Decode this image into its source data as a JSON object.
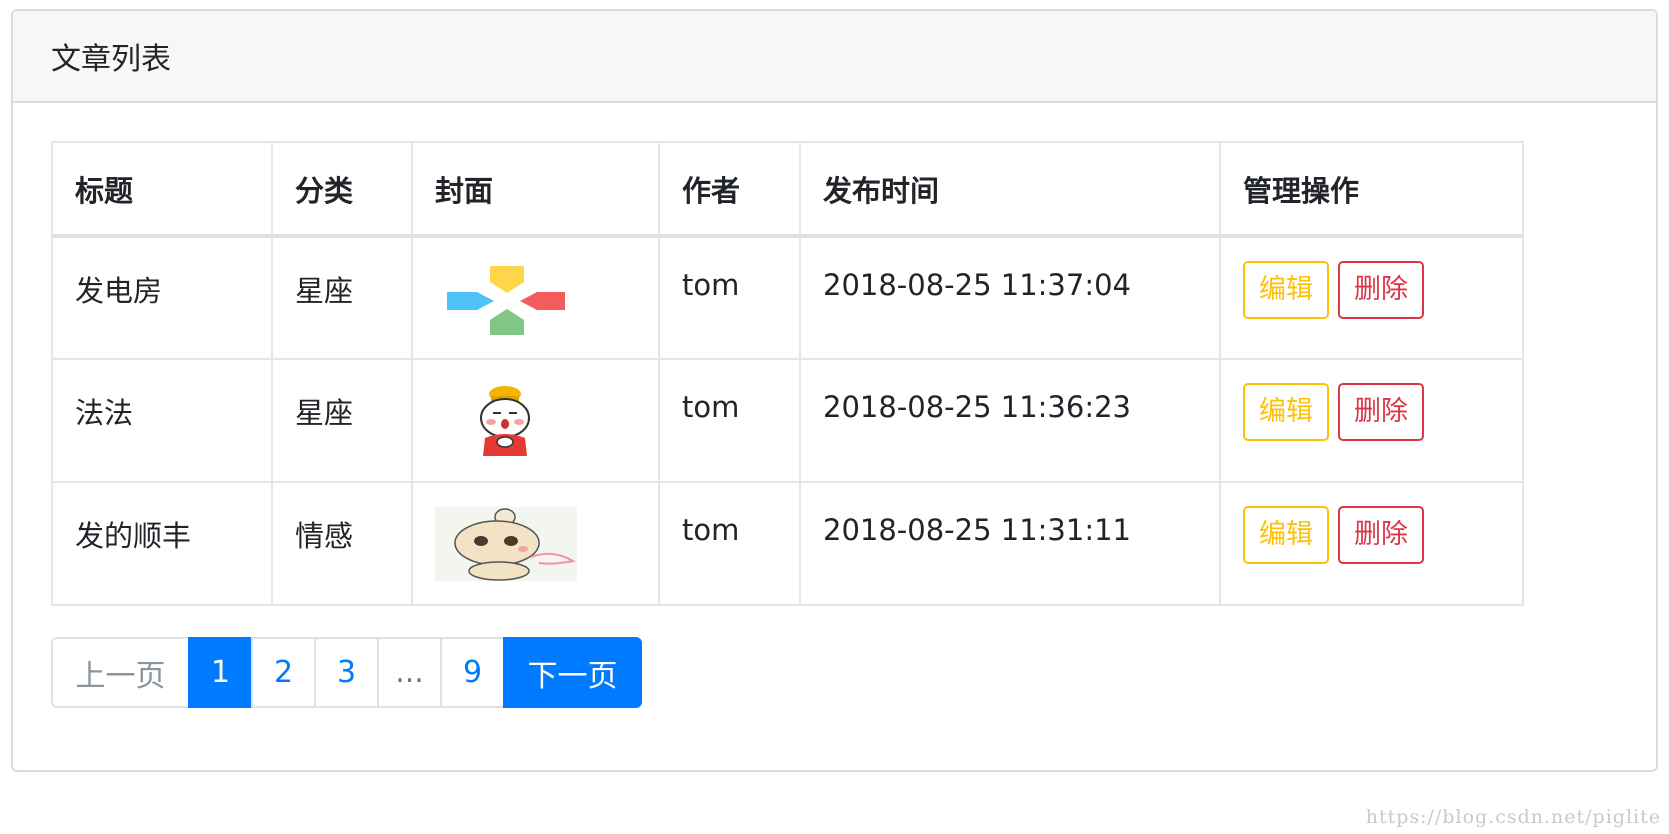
{
  "card": {
    "title": "文章列表"
  },
  "table": {
    "headers": [
      "标题",
      "分类",
      "封面",
      "作者",
      "发布时间",
      "管理操作"
    ],
    "rows": [
      {
        "title": "发电房",
        "category": "星座",
        "cover": "colorful-cross-logo-image",
        "author": "tom",
        "time": "2018-08-25 11:37:04",
        "edit_label": "编辑",
        "delete_label": "删除"
      },
      {
        "title": "法法",
        "category": "星座",
        "cover": "cartoon-cat-new-year-image",
        "author": "tom",
        "time": "2018-08-25 11:36:23",
        "edit_label": "编辑",
        "delete_label": "删除"
      },
      {
        "title": "发的顺丰",
        "category": "情感",
        "cover": "cartoon-cat-bun-image",
        "author": "tom",
        "time": "2018-08-25 11:31:11",
        "edit_label": "编辑",
        "delete_label": "删除"
      }
    ]
  },
  "pagination": {
    "prev_label": "上一页",
    "pages": [
      "1",
      "2",
      "3",
      "...",
      "9"
    ],
    "active_page": "1",
    "next_label": "下一页"
  },
  "watermark": "https://blog.csdn.net/piglite",
  "colors": {
    "primary": "#007bff",
    "warning": "#ffc107",
    "danger": "#dc3545",
    "header_bg": "#f7f7f7"
  }
}
